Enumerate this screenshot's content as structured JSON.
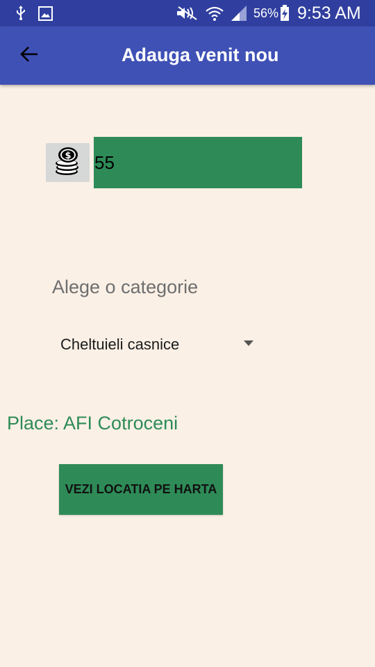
{
  "status_bar": {
    "icons": [
      "usb-icon",
      "image-icon",
      "mute-icon",
      "wifi-icon",
      "signal-icon",
      "battery-charging-icon"
    ],
    "battery_percent": "56%",
    "time": "9:53 AM"
  },
  "app_bar": {
    "back_icon": "arrow-back-icon",
    "title": "Adauga venit nou"
  },
  "amount": {
    "icon": "coins-icon",
    "value": "55"
  },
  "category": {
    "label": "Alege o categorie",
    "selected": "Cheltuieli casnice"
  },
  "place": {
    "text": "Place: AFI Cotroceni"
  },
  "map_button": {
    "label": "VEZI LOCATIA PE HARTA"
  },
  "colors": {
    "status_bar": "#303F9F",
    "app_bar": "#3F51B5",
    "background": "#FAF0E6",
    "accent_green": "#2E8B57",
    "icon_box": "#D6D7D7"
  }
}
